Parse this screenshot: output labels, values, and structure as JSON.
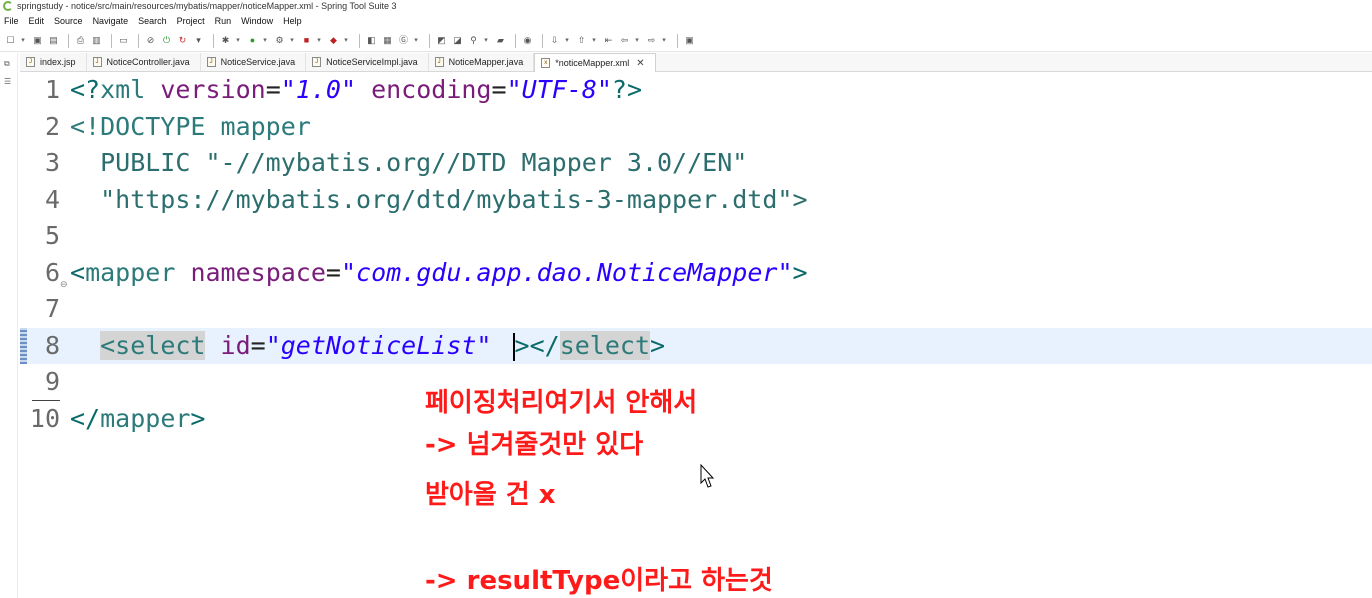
{
  "window": {
    "title": "springstudy - notice/src/main/resources/mybatis/mapper/noticeMapper.xml - Spring Tool Suite 3"
  },
  "menu": [
    "File",
    "Edit",
    "Source",
    "Navigate",
    "Search",
    "Project",
    "Run",
    "Window",
    "Help"
  ],
  "tabs": [
    {
      "label": "index.jsp",
      "icon": "jsp-file-icon",
      "active": false
    },
    {
      "label": "NoticeController.java",
      "icon": "java-file-icon",
      "active": false
    },
    {
      "label": "NoticeService.java",
      "icon": "java-file-icon",
      "active": false
    },
    {
      "label": "NoticeServiceImpl.java",
      "icon": "java-file-icon",
      "active": false
    },
    {
      "label": "NoticeMapper.java",
      "icon": "java-file-icon",
      "active": false
    },
    {
      "label": "*noticeMapper.xml",
      "icon": "xml-file-icon",
      "active": true
    }
  ],
  "editor": {
    "lines": [
      {
        "num": "1",
        "segments": [
          {
            "t": "<?",
            "c": "c-bracket"
          },
          {
            "t": "xml ",
            "c": "c-tag"
          },
          {
            "t": "version",
            "c": "c-attr"
          },
          {
            "t": "=",
            "c": "c-plain"
          },
          {
            "t": "\"1.0\"",
            "c": "c-val"
          },
          {
            "t": " ",
            "c": "c-plain"
          },
          {
            "t": "encoding",
            "c": "c-attr"
          },
          {
            "t": "=",
            "c": "c-plain"
          },
          {
            "t": "\"UTF-8\"",
            "c": "c-val"
          },
          {
            "t": "?>",
            "c": "c-bracket"
          }
        ]
      },
      {
        "num": "2",
        "segments": [
          {
            "t": "<!DOCTYPE mapper",
            "c": "c-tag"
          }
        ]
      },
      {
        "num": "3",
        "segments": [
          {
            "t": "  PUBLIC \"-//mybatis.org//DTD Mapper 3.0//EN\"",
            "c": "c-str"
          }
        ]
      },
      {
        "num": "4",
        "segments": [
          {
            "t": "  \"https://mybatis.org/dtd/mybatis-3-mapper.dtd\">",
            "c": "c-str"
          }
        ]
      },
      {
        "num": "5",
        "segments": []
      },
      {
        "num": "6",
        "fold": true,
        "segments": [
          {
            "t": "<",
            "c": "c-bracket"
          },
          {
            "t": "mapper",
            "c": "c-tag"
          },
          {
            "t": " ",
            "c": "c-plain"
          },
          {
            "t": "namespace",
            "c": "c-attr"
          },
          {
            "t": "=",
            "c": "c-plain"
          },
          {
            "t": "\"com.gdu.app.dao.NoticeMapper\"",
            "c": "c-val"
          },
          {
            "t": ">",
            "c": "c-bracket"
          }
        ]
      },
      {
        "num": "7",
        "segments": []
      },
      {
        "num": "8",
        "current": true,
        "segments": [
          {
            "t": "  ",
            "c": "c-plain"
          },
          {
            "t": "<select",
            "c": "c-tag hl"
          },
          {
            "t": " ",
            "c": "c-plain"
          },
          {
            "t": "id",
            "c": "c-attr"
          },
          {
            "t": "=",
            "c": "c-plain"
          },
          {
            "t": "\"getNoticeList\"",
            "c": "c-val"
          },
          {
            "t": " ",
            "c": "c-plain"
          },
          {
            "t": "CARET",
            "c": "caret"
          },
          {
            "t": "></",
            "c": "c-bracket"
          },
          {
            "t": "select",
            "c": "c-tag hl"
          },
          {
            "t": ">",
            "c": "c-bracket"
          }
        ]
      },
      {
        "num": "9",
        "segments": []
      },
      {
        "num": "10",
        "segments": [
          {
            "t": "</",
            "c": "c-bracket"
          },
          {
            "t": "mapper",
            "c": "c-tag"
          },
          {
            "t": ">",
            "c": "c-bracket"
          }
        ]
      }
    ]
  },
  "annotation": {
    "lines": [
      "페이징처리여기서 안해서",
      "-> 넘겨줄것만 있다",
      "받아올 건 x",
      "",
      "-> resultType이라고 하는것"
    ]
  }
}
